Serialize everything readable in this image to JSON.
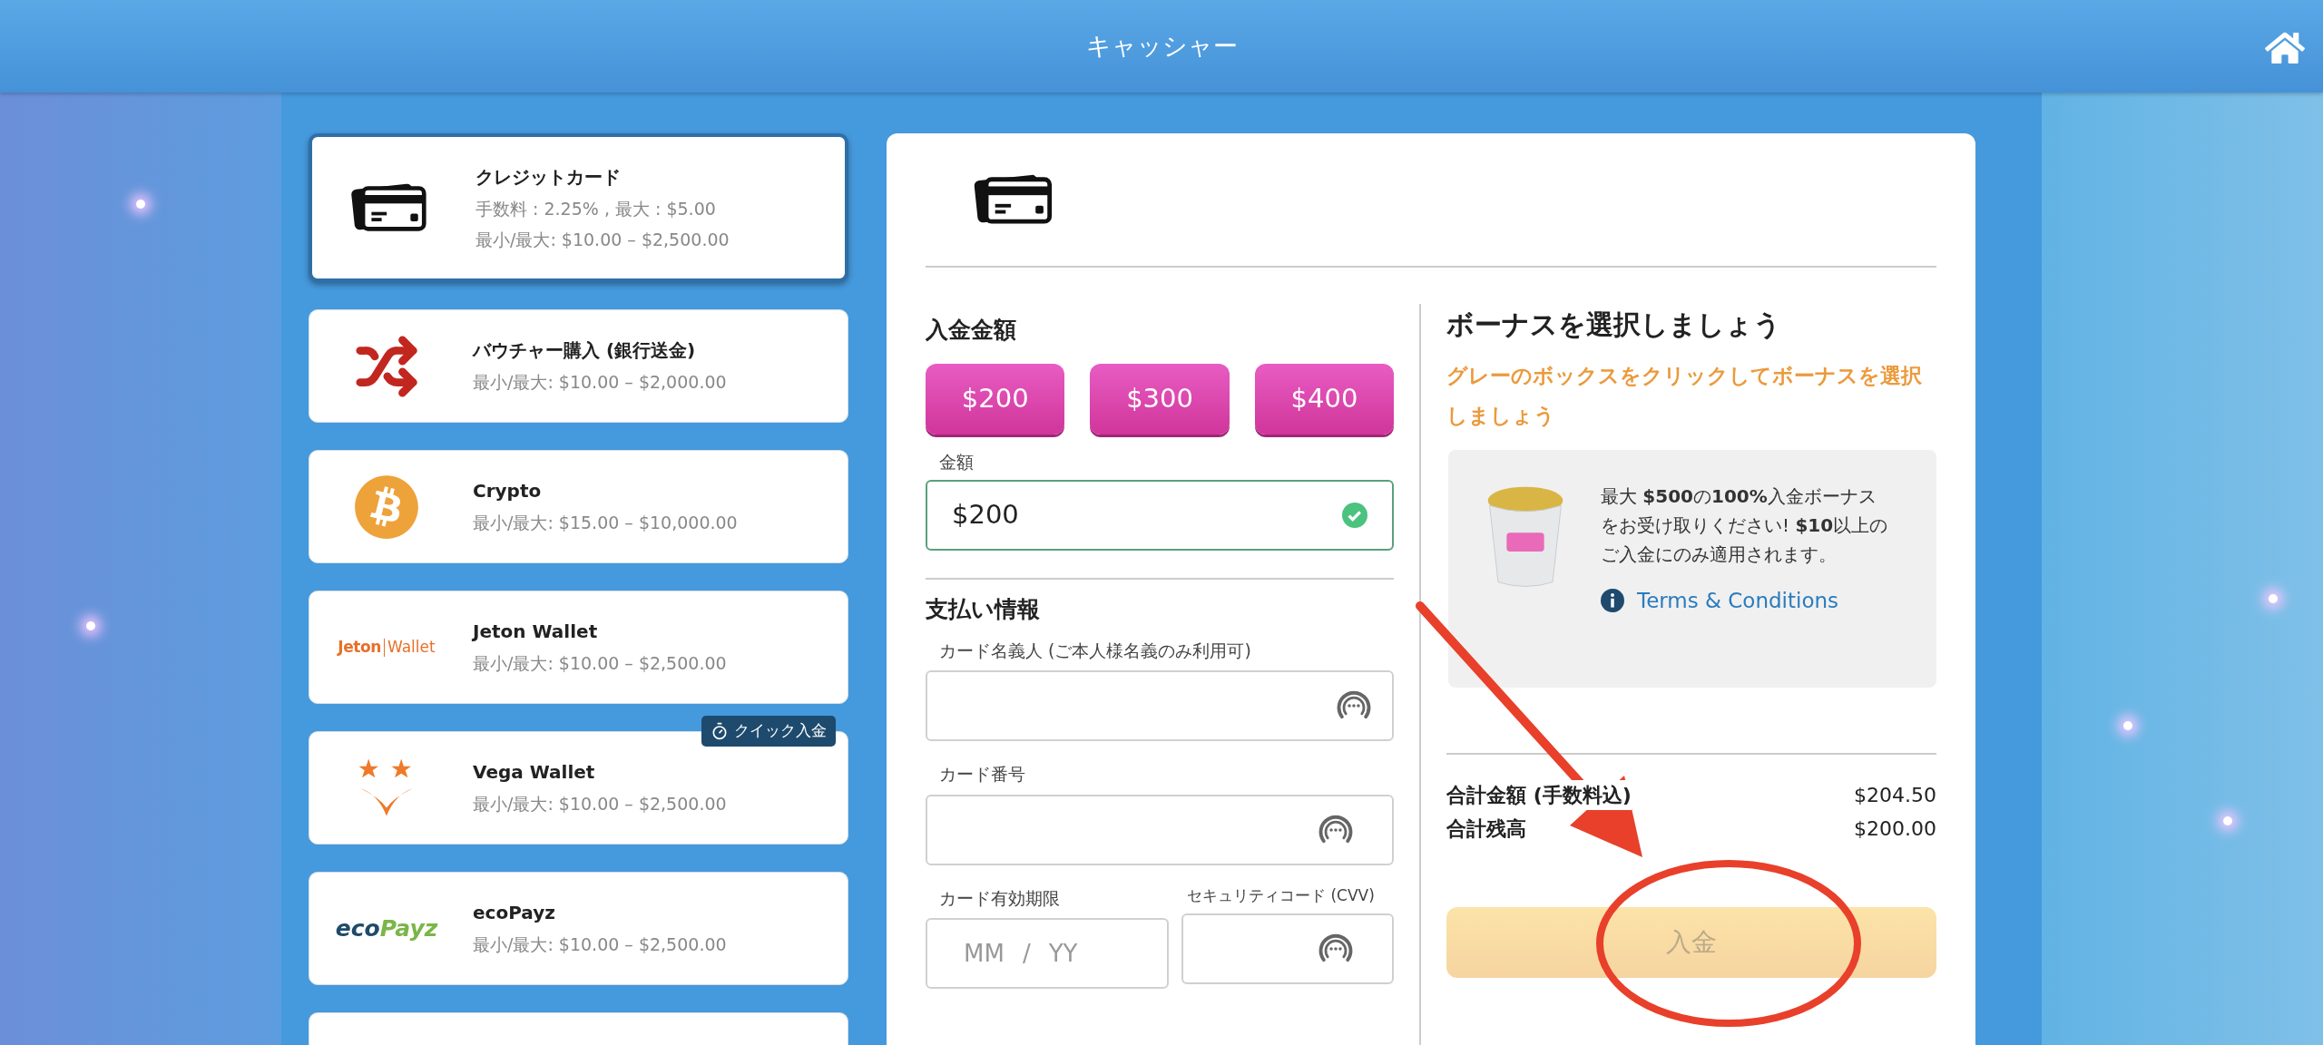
{
  "header": {
    "title": "キャッシャー"
  },
  "methods": [
    {
      "kind": "card",
      "name": "クレジットカード",
      "fee": "手数料 : 2.25% , 最大 : $5.00",
      "limits": "最小/最大: $10.00 – $2,500.00",
      "selected": true
    },
    {
      "kind": "shuffle",
      "name": "バウチャー購入 (銀行送金)",
      "limits": "最小/最大: $10.00 – $2,000.00",
      "selected": false
    },
    {
      "kind": "bitcoin",
      "name": "Crypto",
      "limits": "最小/最大: $15.00 – $10,000.00",
      "selected": false
    },
    {
      "kind": "jeton",
      "logo": [
        "Jeton",
        "Wallet"
      ],
      "name": "Jeton Wallet",
      "limits": "最小/最大: $10.00 – $2,500.00",
      "selected": false
    },
    {
      "kind": "vega",
      "badge": "クイック入金",
      "name": "Vega Wallet",
      "limits": "最小/最大: $10.00 – $2,500.00",
      "selected": false
    },
    {
      "kind": "ecopayz",
      "logo": [
        "eco",
        "Payz"
      ],
      "name": "ecoPayz",
      "limits": "最小/最大: $10.00 – $2,500.00",
      "selected": false
    },
    {
      "kind": "blank",
      "selected": false
    }
  ],
  "amount": {
    "title": "入金金額",
    "presets": [
      {
        "label": "$200"
      },
      {
        "label": "$300"
      },
      {
        "label": "$400"
      }
    ],
    "field_label": "金額",
    "value": "$200",
    "valid": true
  },
  "payment": {
    "title": "支払い情報",
    "holder_label": "カード名義人 (ご本人様名義のみ利用可)",
    "number_label": "カード番号",
    "expiry_label": "カード有効期限",
    "expiry_placeholder": [
      "MM",
      "/",
      "YY"
    ],
    "cvv_label": "セキュリティコード (CVV)"
  },
  "bonus": {
    "title": "ボーナスを選択しましょう",
    "hint": "グレーのボックスをクリックしてボーナスを選択しましょう",
    "offer": "最大 **$500**の**100%**入金ボーナスをお受け取りください! **$10**以上のご入金にのみ適用されます。",
    "terms": "Terms & Conditions"
  },
  "totals": [
    {
      "label": "合計金額 (手数料込)",
      "value": "$204.50"
    },
    {
      "label": "合計残高",
      "value": "$200.00"
    }
  ],
  "submit": {
    "label": "入金",
    "disabled": true
  }
}
